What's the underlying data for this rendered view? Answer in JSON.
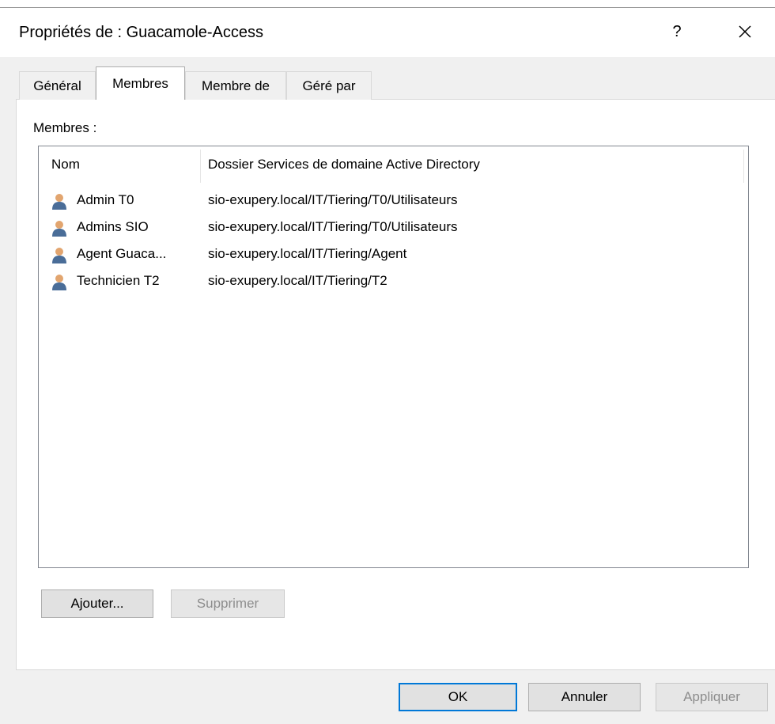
{
  "window": {
    "title": "Propriétés de : Guacamole-Access",
    "help_label": "?"
  },
  "tabs": [
    {
      "label": "Général",
      "active": false
    },
    {
      "label": "Membres",
      "active": true
    },
    {
      "label": "Membre de",
      "active": false
    },
    {
      "label": "Géré par",
      "active": false
    }
  ],
  "members": {
    "label": "Membres :",
    "columns": [
      "Nom",
      "Dossier Services de domaine Active Directory"
    ],
    "rows": [
      {
        "name": "Admin T0",
        "folder": "sio-exupery.local/IT/Tiering/T0/Utilisateurs",
        "icon": "user-icon"
      },
      {
        "name": "Admins SIO",
        "folder": "sio-exupery.local/IT/Tiering/T0/Utilisateurs",
        "icon": "user-icon"
      },
      {
        "name": "Agent Guaca...",
        "folder": "sio-exupery.local/IT/Tiering/Agent",
        "icon": "user-icon"
      },
      {
        "name": "Technicien T2",
        "folder": "sio-exupery.local/IT/Tiering/T2",
        "icon": "user-icon"
      }
    ],
    "add_label": "Ajouter...",
    "remove_label": "Supprimer"
  },
  "footer": {
    "ok_label": "OK",
    "cancel_label": "Annuler",
    "apply_label": "Appliquer"
  },
  "colors": {
    "accent": "#0078d7",
    "user_icon_body": "#4a6d98",
    "user_icon_head": "#e2a56f"
  }
}
